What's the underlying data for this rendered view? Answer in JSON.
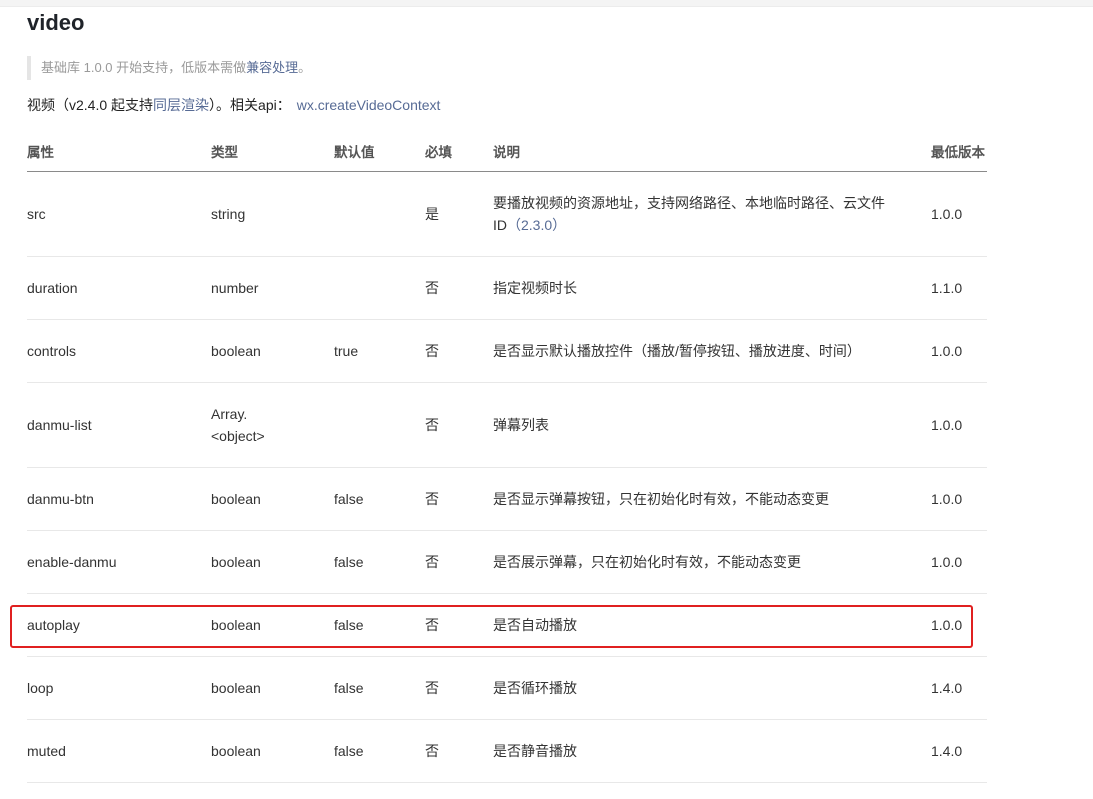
{
  "title": "video",
  "note": {
    "text": "基础库 1.0.0 开始支持，低版本需做",
    "link": "兼容处理",
    "suffix": "。"
  },
  "desc": {
    "text1": "视频（v2.4.0 起支持",
    "link1": "同层渲染",
    "text2": "）。相关api：",
    "link2": "wx.createVideoContext"
  },
  "table": {
    "headers": [
      "属性",
      "类型",
      "默认值",
      "必填",
      "说明",
      "最低版本"
    ],
    "rows": [
      {
        "name": "src",
        "type": "string",
        "type2": "",
        "default": "",
        "required": "是",
        "desc": "要播放视频的资源地址，支持网络路径、本地临时路径、云文件",
        "desc2": "ID",
        "desc2_ver": "（2.3.0）",
        "version": "1.0.0"
      },
      {
        "name": "duration",
        "type": "number",
        "type2": "",
        "default": "",
        "required": "否",
        "desc": "指定视频时长",
        "desc2": "",
        "desc2_ver": "",
        "version": "1.1.0"
      },
      {
        "name": "controls",
        "type": "boolean",
        "type2": "",
        "default": "true",
        "required": "否",
        "desc": "是否显示默认播放控件（播放/暂停按钮、播放进度、时间）",
        "desc2": "",
        "desc2_ver": "",
        "version": "1.0.0"
      },
      {
        "name": "danmu-list",
        "type": "Array.",
        "type2": "<object>",
        "default": "",
        "required": "否",
        "desc": "弹幕列表",
        "desc2": "",
        "desc2_ver": "",
        "version": "1.0.0"
      },
      {
        "name": "danmu-btn",
        "type": "boolean",
        "type2": "",
        "default": "false",
        "required": "否",
        "desc": "是否显示弹幕按钮，只在初始化时有效，不能动态变更",
        "desc2": "",
        "desc2_ver": "",
        "version": "1.0.0"
      },
      {
        "name": "enable-danmu",
        "type": "boolean",
        "type2": "",
        "default": "false",
        "required": "否",
        "desc": "是否展示弹幕，只在初始化时有效，不能动态变更",
        "desc2": "",
        "desc2_ver": "",
        "version": "1.0.0"
      },
      {
        "name": "autoplay",
        "type": "boolean",
        "type2": "",
        "default": "false",
        "required": "否",
        "desc": "是否自动播放",
        "desc2": "",
        "desc2_ver": "",
        "version": "1.0.0"
      },
      {
        "name": "loop",
        "type": "boolean",
        "type2": "",
        "default": "false",
        "required": "否",
        "desc": "是否循环播放",
        "desc2": "",
        "desc2_ver": "",
        "version": "1.4.0"
      },
      {
        "name": "muted",
        "type": "boolean",
        "type2": "",
        "default": "false",
        "required": "否",
        "desc": "是否静音播放",
        "desc2": "",
        "desc2_ver": "",
        "version": "1.4.0"
      }
    ]
  },
  "colors": {
    "link": "#576b95",
    "highlight_border": "#e02020"
  }
}
